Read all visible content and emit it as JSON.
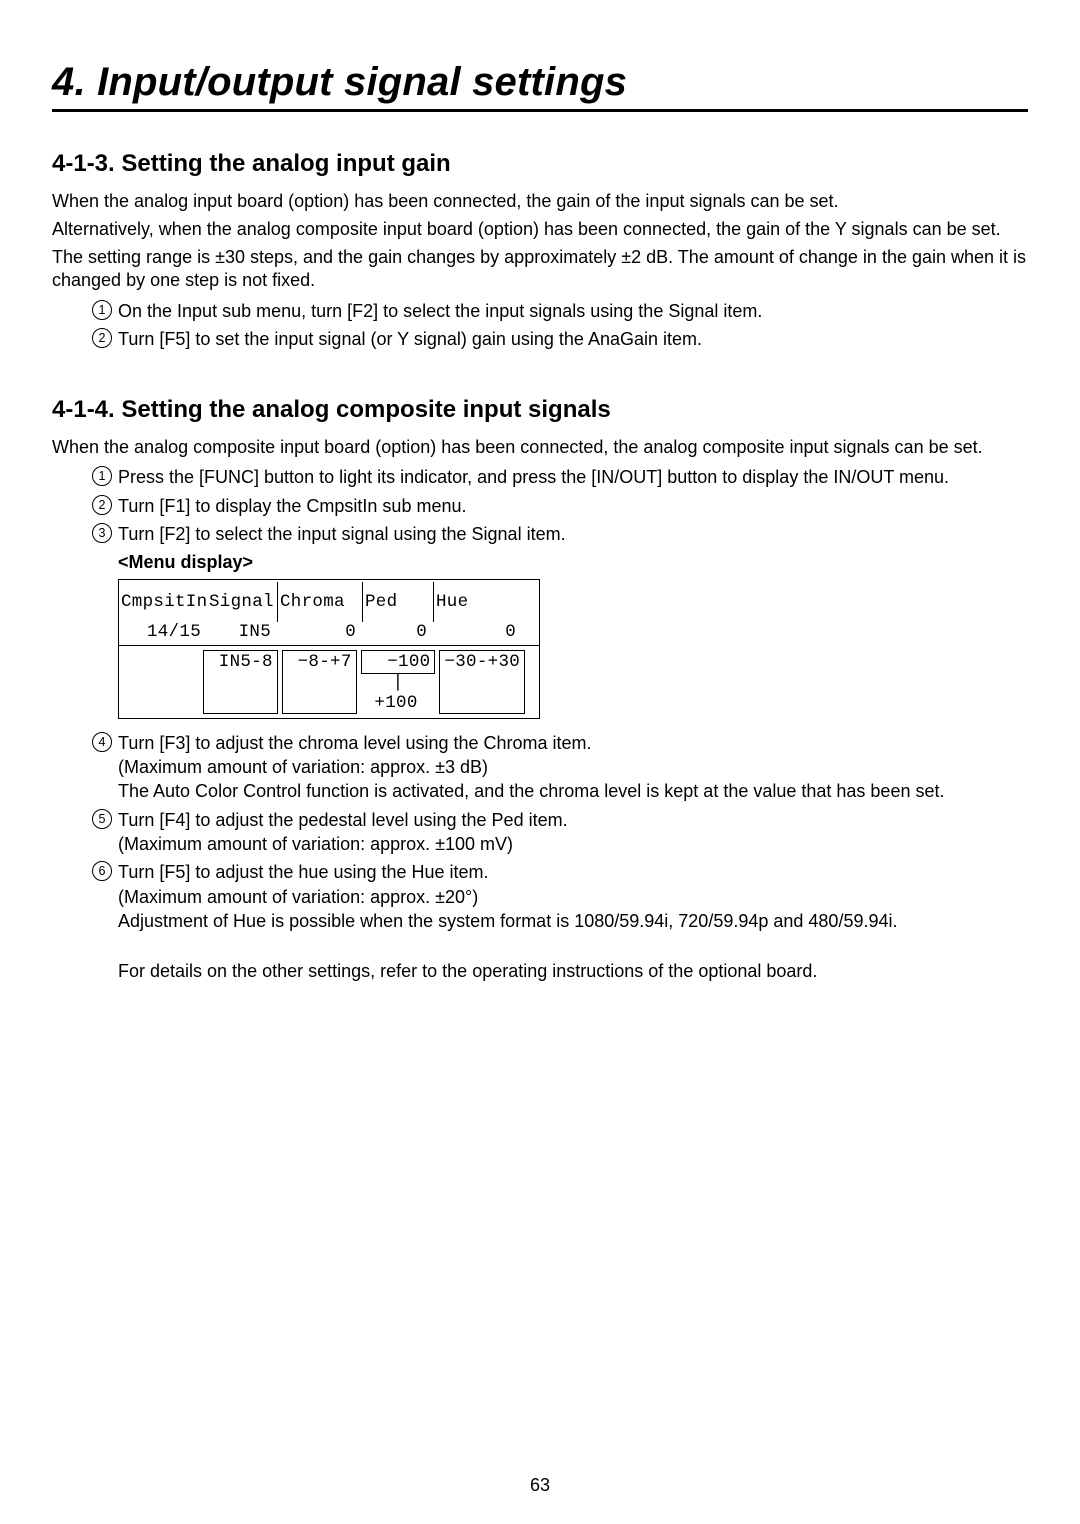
{
  "chapter_title": "4. Input/output signal settings",
  "section413": {
    "title": "4-1-3. Setting the analog input gain",
    "p1": "When the analog input board (option) has been connected, the gain of the input signals can be set.",
    "p2": "Alternatively, when the analog composite input board (option) has been connected, the gain of the Y signals can be set.",
    "p3": "The setting range is ±30 steps, and the gain changes by approximately ±2 dB. The amount of change in the gain when it is changed by one step is not fixed.",
    "step1": "On the Input sub menu, turn [F2] to select the input signals using the Signal item.",
    "step2": "Turn [F5] to set the input signal (or Y signal) gain using the AnaGain item."
  },
  "section414": {
    "title": "4-1-4. Setting the analog composite input signals",
    "p1": "When the analog composite input board (option) has been connected, the analog composite input signals can be set.",
    "step1": "Press the [FUNC] button to light its indicator, and press the [IN/OUT] button to display the IN/OUT menu.",
    "step2": "Turn [F1] to display the CmpsitIn sub menu.",
    "step3": "Turn [F2] to select the input signal using the Signal item.",
    "menu_heading": "<Menu display>",
    "menu": {
      "h0": "CmpsitIn",
      "h1": "Signal",
      "h2": "Chroma",
      "h3": "Ped",
      "h4": "Hue",
      "v0": "14/15",
      "v1": "IN5",
      "v2": "0",
      "v3": "0",
      "v4": "0",
      "r_signal": " IN5-8",
      "r_chroma": " −8-+7",
      "r_ped_top": "  −100",
      "r_ped_bot": "+100",
      "r_hue": "−30-+30"
    },
    "step4a": "Turn [F3] to adjust the chroma level using the Chroma item.",
    "step4b": "(Maximum amount of variation: approx. ±3 dB)",
    "step4c": "The Auto Color Control function is activated, and the chroma level is kept at the value that has been set.",
    "step5a": "Turn [F4] to adjust the pedestal level using the Ped item.",
    "step5b": "(Maximum amount of variation: approx. ±100 mV)",
    "step6a": "Turn [F5] to adjust the hue using the Hue item.",
    "step6b": "(Maximum amount of variation: approx. ±20°)",
    "step6c": "Adjustment of Hue is possible when the system format is 1080/59.94i, 720/59.94p and 480/59.94i.",
    "footer": "For details on the other settings, refer to the operating instructions of the optional board."
  },
  "page_number": "63",
  "circled": {
    "n1": "1",
    "n2": "2",
    "n3": "3",
    "n4": "4",
    "n5": "5",
    "n6": "6"
  }
}
